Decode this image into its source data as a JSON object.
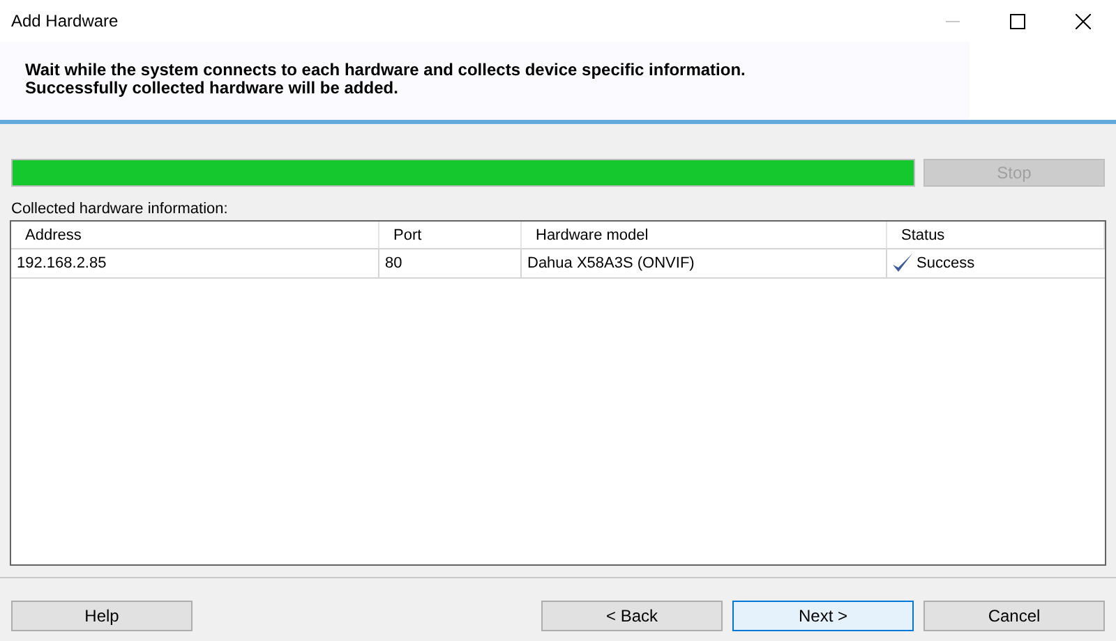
{
  "window": {
    "title": "Add Hardware"
  },
  "header": {
    "lines": [
      "Wait while the system connects to each hardware and collects device specific information.",
      "Successfully collected hardware will be added."
    ]
  },
  "progress": {
    "level": 1.0
  },
  "stop_button": {
    "label": "Stop",
    "disabled": true
  },
  "table": {
    "caption": "Collected hardware information:",
    "columns": [
      "Address",
      "Port",
      "Hardware model",
      "Status"
    ],
    "rows": [
      {
        "cells": [
          "192.168.2.85",
          "80",
          "Dahua X58A3S (ONVIF)",
          "Success"
        ]
      }
    ]
  },
  "buttons": [
    {
      "label": "Help",
      "default": false
    },
    {
      "label": "< Back",
      "default": false
    },
    {
      "label": "Next >",
      "default": true
    },
    {
      "label": "Cancel",
      "default": false
    }
  ]
}
